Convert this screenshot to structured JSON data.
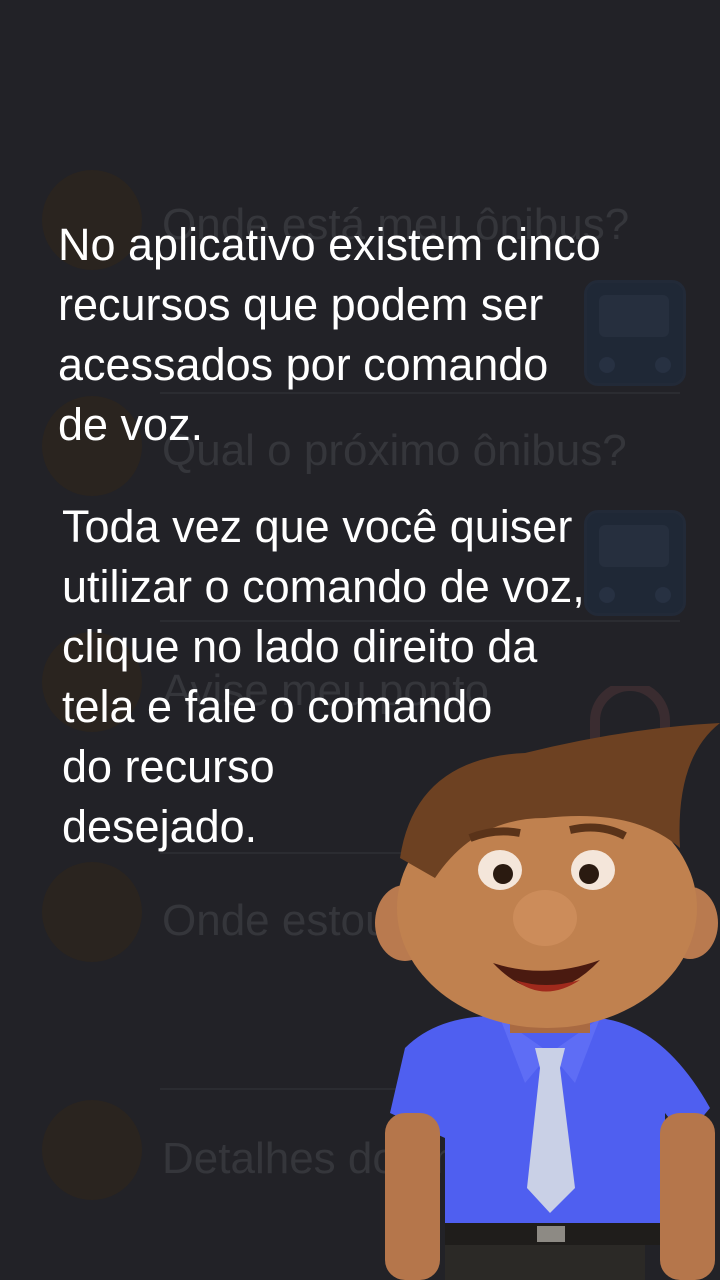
{
  "menu": {
    "items": [
      {
        "label": "Onde está meu ônibus?"
      },
      {
        "label": "Qual o próximo ônibus?"
      },
      {
        "label": "Avise meu ponto"
      },
      {
        "label": "Onde estou?"
      },
      {
        "label": "Detalhes do ônibus"
      }
    ]
  },
  "tutorial": {
    "intro": "No aplicativo existem cinco\nrecursos que podem ser\nacessados por comando\nde voz.",
    "instruction": "Toda vez que você quiser\nutilizar o comando de voz,\nclique no lado direito da\ntela e fale o comando\ndo recurso\ndesejado."
  },
  "icons": [
    "bus-icon",
    "bus-icon",
    "lock-icon",
    "mascot-character"
  ],
  "colors": {
    "background": "#222227",
    "overlay_text": "#ffffff",
    "mascot_shirt": "#4f5ff0",
    "mascot_tie": "#c9d0e6"
  }
}
